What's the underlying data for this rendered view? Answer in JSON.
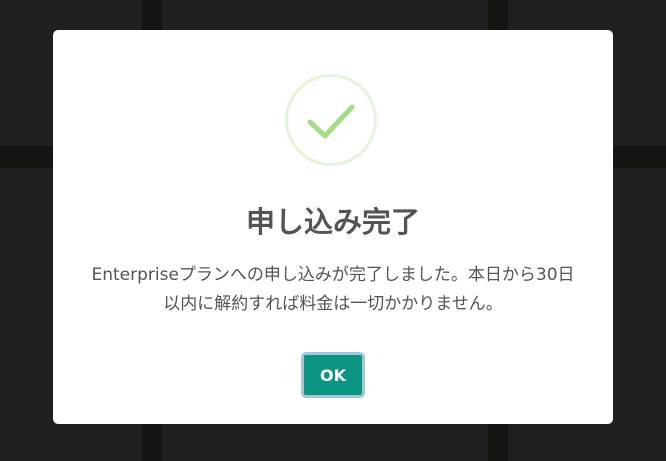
{
  "dialog": {
    "icon": "success-check-icon",
    "title": "申し込み完了",
    "message": "Enterpriseプランへの申し込みが完了しました。本日から30日以内に解約すれば料金は一切かかりません。",
    "ok_label": "OK"
  },
  "colors": {
    "accent": "#0c9582",
    "success": "#a5dc86",
    "text": "#545454",
    "overlay": "#202020"
  }
}
